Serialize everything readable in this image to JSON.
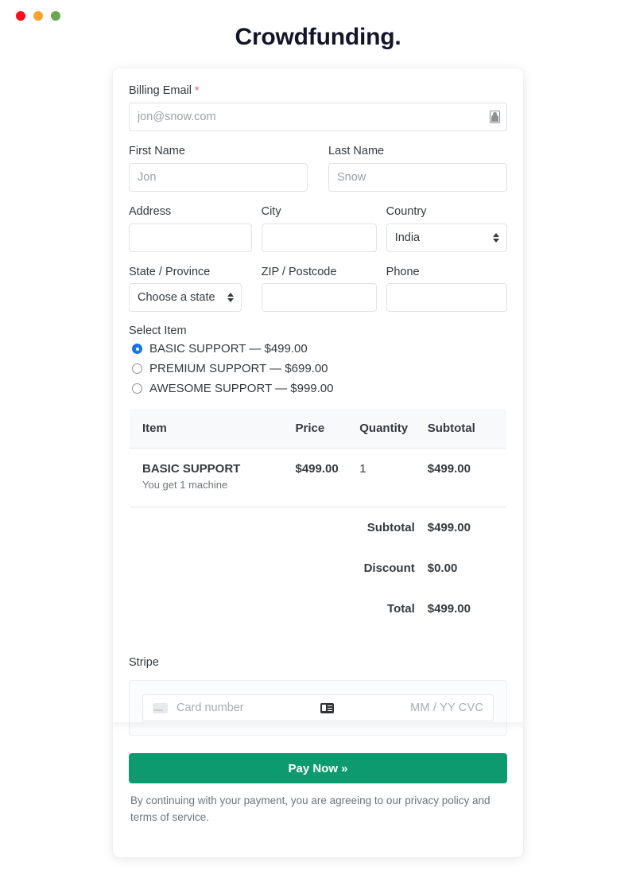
{
  "window": {
    "traffic_lights": [
      {
        "name": "close",
        "color": "#fc0d1b"
      },
      {
        "name": "minimize",
        "color": "#fca12c"
      },
      {
        "name": "zoom",
        "color": "#6aa84f"
      }
    ]
  },
  "header": {
    "title": "Crowdfunding."
  },
  "form": {
    "billing_email": {
      "label": "Billing Email",
      "required_mark": "*",
      "value": "",
      "placeholder": "jon@snow.com",
      "autofill_icon": "contact-card-icon"
    },
    "first_name": {
      "label": "First Name",
      "value": "",
      "placeholder": "Jon"
    },
    "last_name": {
      "label": "Last Name",
      "value": "",
      "placeholder": "Snow"
    },
    "address": {
      "label": "Address",
      "value": "",
      "placeholder": ""
    },
    "city": {
      "label": "City",
      "value": "",
      "placeholder": ""
    },
    "country": {
      "label": "Country",
      "selected": "India",
      "options": [
        "India"
      ]
    },
    "state": {
      "label": "State / Province",
      "selected": "Choose a state",
      "options": [
        "Choose a state"
      ]
    },
    "zip": {
      "label": "ZIP / Postcode",
      "value": "",
      "placeholder": ""
    },
    "phone": {
      "label": "Phone",
      "value": "",
      "placeholder": ""
    }
  },
  "select_item": {
    "label": "Select Item",
    "options": [
      {
        "label": "BASIC SUPPORT — $499.00",
        "selected": true
      },
      {
        "label": "PREMIUM SUPPORT — $699.00",
        "selected": false
      },
      {
        "label": "AWESOME SUPPORT — $999.00",
        "selected": false
      }
    ]
  },
  "order_table": {
    "headers": [
      "Item",
      "Price",
      "Quantity",
      "Subtotal"
    ],
    "rows": [
      {
        "item": "BASIC SUPPORT",
        "description": "You get 1 machine",
        "price": "$499.00",
        "quantity": "1",
        "subtotal": "$499.00"
      }
    ],
    "totals": [
      {
        "label": "Subtotal",
        "value": "$499.00"
      },
      {
        "label": "Discount",
        "value": "$0.00"
      },
      {
        "label": "Total",
        "value": "$499.00"
      }
    ]
  },
  "stripe": {
    "title": "Stripe",
    "card_number_placeholder": "Card number",
    "card_number_value": "",
    "expiry_cvc_placeholder": "MM / YY  CVC",
    "card_brand_icon": "credit-card-icon",
    "autofill_icon": "credit-card-autofill-icon"
  },
  "pay": {
    "button_label": "Pay Now »",
    "button_color": "#0c9a6e",
    "terms": "By continuing with your payment, you are agreeing to our privacy policy and terms of service."
  }
}
